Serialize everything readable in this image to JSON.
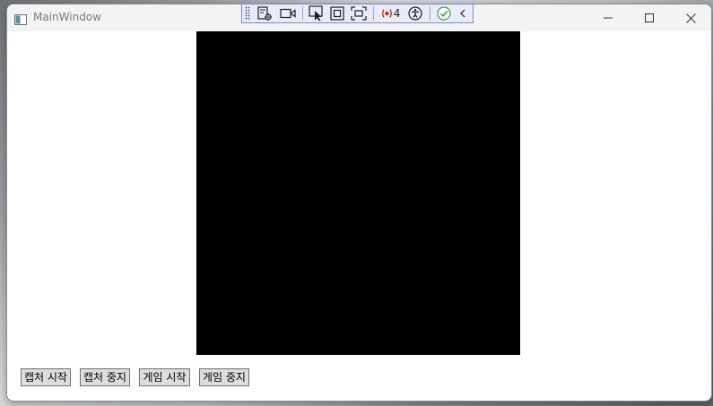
{
  "window": {
    "title": "MainWindow"
  },
  "debug_toolbar": {
    "binding_failures_count": "4"
  },
  "buttons": {
    "start_capture": "캡처 시작",
    "stop_capture": "캡처 중지",
    "start_game": "게임 시작",
    "stop_game": "게임 중지"
  },
  "colors": {
    "capture_background": "#000000",
    "titlebar": "#f3f3f3",
    "toolbar_background": "#e9ecf8",
    "toolbar_border": "#7b86c7",
    "button_face": "#dddddd"
  }
}
